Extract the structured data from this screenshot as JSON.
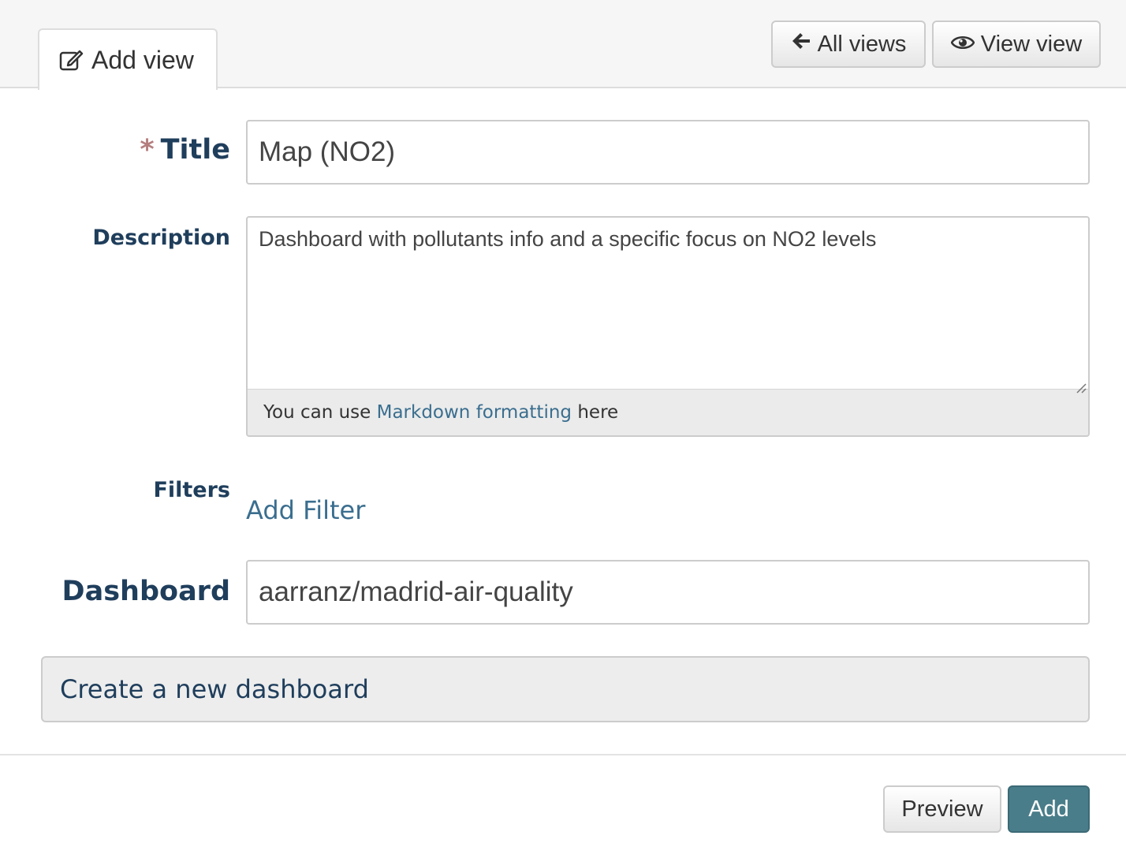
{
  "header": {
    "tab_label": "Add view",
    "all_views_label": "All views",
    "view_view_label": "View view"
  },
  "form": {
    "required_marker": "*",
    "title_label": "Title",
    "title_value": "Map (NO2)",
    "description_label": "Description",
    "description_value": "Dashboard with pollutants info and a specific focus on NO2 levels",
    "markdown_hint_prefix": "You can use",
    "markdown_link": "Markdown formatting",
    "markdown_hint_suffix": "here",
    "filters_label": "Filters",
    "add_filter_link": "Add Filter",
    "dashboard_label": "Dashboard",
    "dashboard_value": "aarranz/madrid-air-quality",
    "create_dashboard_label": "Create a new dashboard"
  },
  "actions": {
    "preview_label": "Preview",
    "add_label": "Add"
  },
  "icons": {
    "tab_icon": "edit-icon",
    "all_views_icon": "arrow-left-icon",
    "view_view_icon": "eye-icon"
  },
  "colors": {
    "label_color": "#1f3e5c",
    "link_color": "#3a6e8f",
    "primary_button": "#4a7d8a",
    "required_marker": "#b47e7e"
  }
}
